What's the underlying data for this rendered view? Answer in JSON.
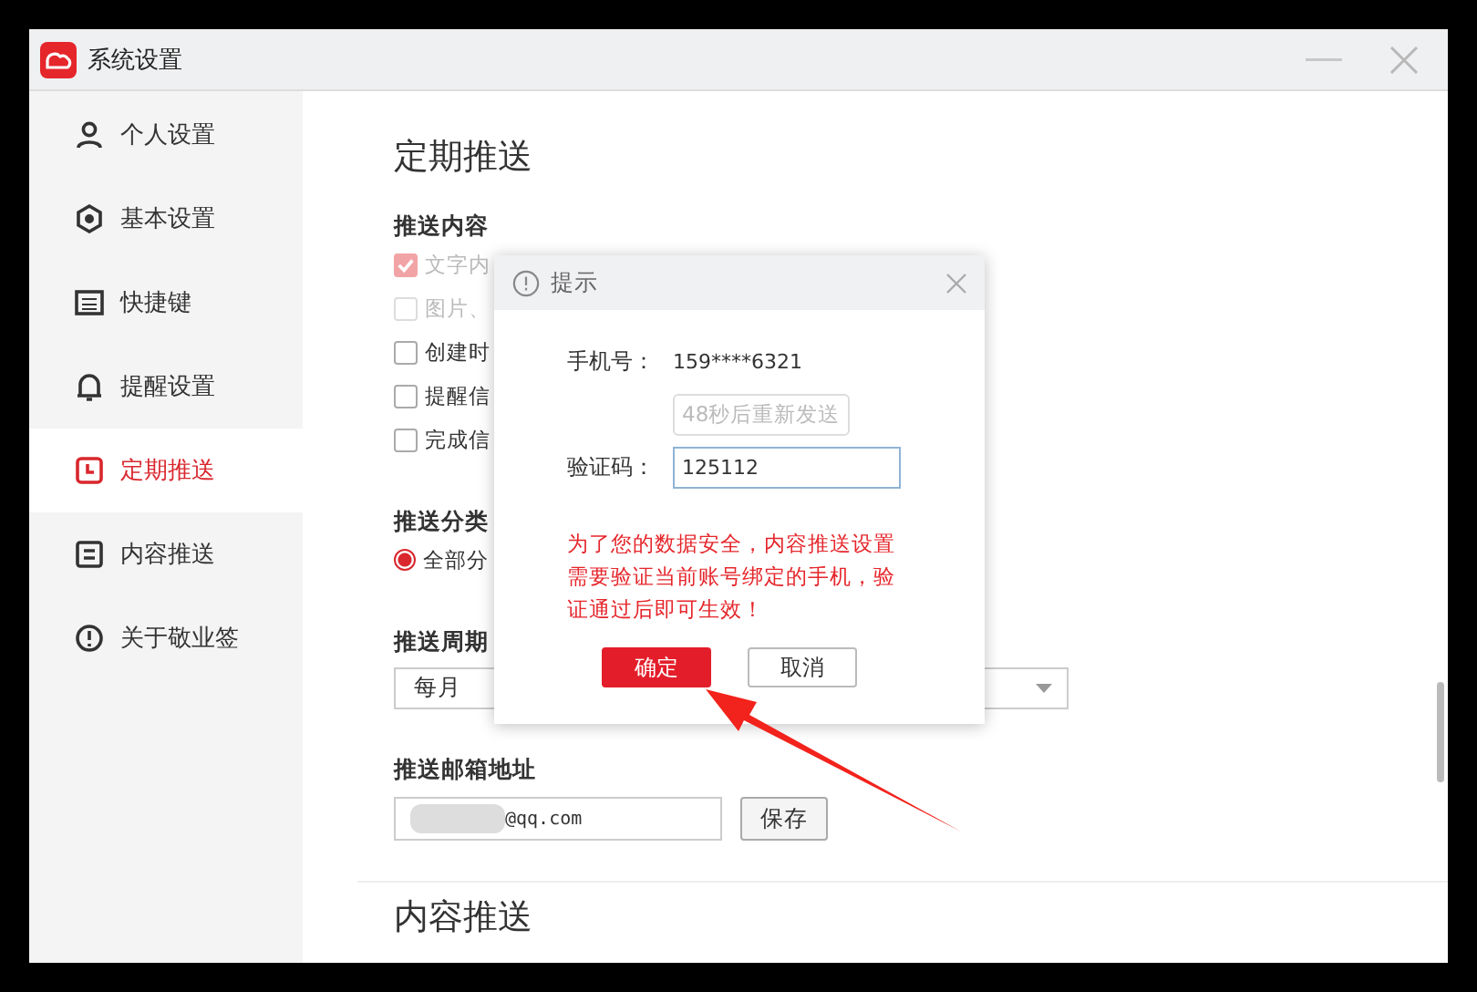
{
  "window": {
    "title": "系统设置"
  },
  "sidebar": {
    "items": [
      {
        "label": "个人设置",
        "selected": false
      },
      {
        "label": "基本设置",
        "selected": false
      },
      {
        "label": "快捷键",
        "selected": false
      },
      {
        "label": "提醒设置",
        "selected": false
      },
      {
        "label": "定期推送",
        "selected": true
      },
      {
        "label": "内容推送",
        "selected": false
      },
      {
        "label": "关于敬业签",
        "selected": false
      }
    ]
  },
  "page": {
    "heading": "定期推送",
    "content_section": {
      "title": "推送内容",
      "options": [
        {
          "label": "文字内",
          "checked": true,
          "disabled": true
        },
        {
          "label": "图片、",
          "checked": false,
          "disabled": true
        },
        {
          "label": "创建时",
          "checked": false,
          "disabled": false
        },
        {
          "label": "提醒信",
          "checked": false,
          "disabled": false
        },
        {
          "label": "完成信",
          "checked": false,
          "disabled": false
        }
      ]
    },
    "category_section": {
      "title": "推送分类",
      "options": [
        {
          "label": "全部分",
          "selected": true
        }
      ]
    },
    "period_section": {
      "title": "推送周期",
      "value": "每月"
    },
    "email_section": {
      "title": "推送邮箱地址",
      "value": "@qq.com",
      "save": "保存"
    },
    "next_heading": "内容推送"
  },
  "dialog": {
    "title": "提示",
    "phone_label": "手机号：",
    "phone": "159****6321",
    "resend": {
      "label": "48秒后重新发送",
      "disabled": true
    },
    "code_label": "验证码：",
    "code": "125112",
    "warning": "为了您的数据安全，内容推送设置需要验证当前账号绑定的手机，验证通过后即可生效！",
    "buttons": [
      {
        "label": "确定",
        "kind": "primary"
      },
      {
        "label": "取消",
        "kind": "secondary"
      }
    ]
  }
}
